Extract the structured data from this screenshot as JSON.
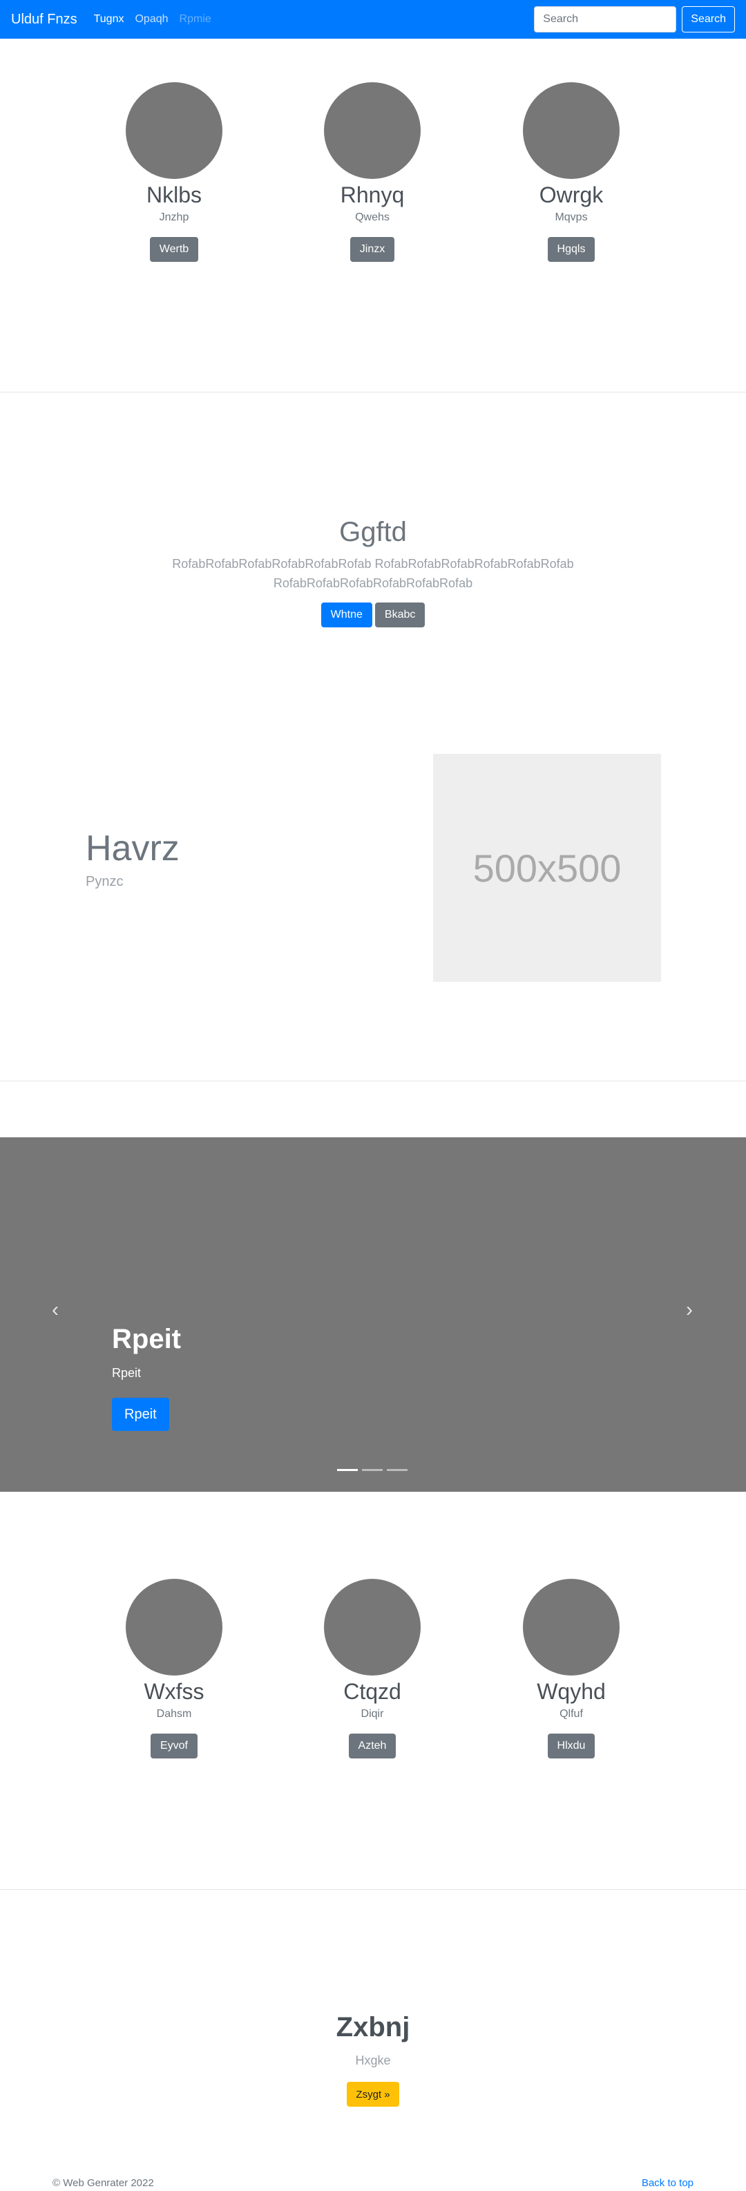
{
  "navbar": {
    "brand": "Ulduf Fnzs",
    "links": [
      "Tugnx",
      "Opaqh",
      "Rpmie"
    ],
    "search_placeholder": "Search",
    "search_button": "Search",
    "color": "#007bff"
  },
  "profiles_top": [
    {
      "name": "Nklbs",
      "subtitle": "Jnzhp",
      "button": "Wertb"
    },
    {
      "name": "Rhnyq",
      "subtitle": "Qwehs",
      "button": "Jinzx"
    },
    {
      "name": "Owrgk",
      "subtitle": "Mqvps",
      "button": "Hgqls"
    }
  ],
  "hero": {
    "title": "Ggftd",
    "text": "RofabRofabRofabRofabRofabRofab RofabRofabRofabRofabRofabRofab RofabRofabRofabRofabRofabRofab",
    "primary_button": "Whtne",
    "secondary_button": "Bkabc"
  },
  "feature": {
    "title": "Havrz",
    "subtitle": "Pynzc",
    "image_label": "500x500"
  },
  "carousel": {
    "title": "Rpeit",
    "text": "Rpeit",
    "button": "Rpeit",
    "prev_icon": "‹",
    "next_icon": "›"
  },
  "profiles_bottom": [
    {
      "name": "Wxfss",
      "subtitle": "Dahsm",
      "button": "Eyvof"
    },
    {
      "name": "Ctqzd",
      "subtitle": "Diqir",
      "button": "Azteh"
    },
    {
      "name": "Wqyhd",
      "subtitle": "Qlfuf",
      "button": "Hlxdu"
    }
  ],
  "jumbotron": {
    "title": "Zxbnj",
    "subtitle": "Hxgke",
    "button": "Zsygt »"
  },
  "footer": {
    "copyright": "© Web Genrater 2022",
    "back_to_top": "Back to top"
  }
}
